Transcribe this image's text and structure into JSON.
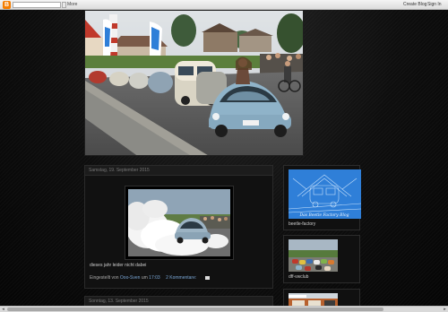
{
  "navbar": {
    "logo_letter": "B",
    "search_placeholder": "",
    "more_label": "More",
    "create_blog_label": "Create Blog",
    "sign_in_label": "Sign In"
  },
  "posts": [
    {
      "date": "Samstag, 19. September 2015",
      "body": "dieses jahr leider nicht dabei",
      "footer": {
        "posted_by_label": "Eingestellt von",
        "author": "Ooo-Sven",
        "at_label": "um",
        "time": "17:03",
        "comments": "2 Kommentare:",
        "email_icon": "email-icon"
      }
    },
    {
      "date": "Sonntag, 13. September 2015"
    }
  ],
  "sidebar": {
    "widgets": [
      {
        "caption": "beetle-factory",
        "image_text": "Das Beetle Factory Blog"
      },
      {
        "caption": "dff-vwclub"
      },
      {
        "caption": ""
      }
    ]
  },
  "scrollbar": {
    "left_arrow": "◂",
    "right_arrow": "▸"
  },
  "colors": {
    "background": "#0b0b0b",
    "link": "#7aa7d6",
    "beetle_blue": "#8fb3c9",
    "banner_blue": "#2f7fd8"
  }
}
